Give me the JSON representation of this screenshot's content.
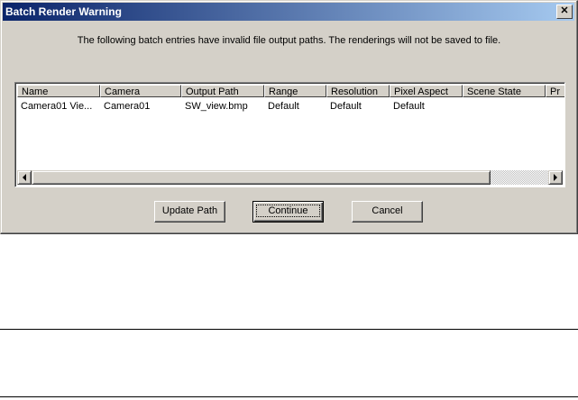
{
  "dialog": {
    "title": "Batch Render Warning",
    "close_glyph": "✕",
    "message": "The following batch entries have invalid file output paths. The renderings will not be saved to file."
  },
  "table": {
    "columns": [
      "Name",
      "Camera",
      "Output Path",
      "Range",
      "Resolution",
      "Pixel Aspect",
      "Scene State",
      "Pr"
    ],
    "rows": [
      [
        "Camera01 Vie...",
        "Camera01",
        "SW_view.bmp",
        "Default",
        "Default",
        "Default",
        "",
        ""
      ]
    ]
  },
  "buttons": {
    "update_path": "Update Path",
    "continue": "Continue",
    "cancel": "Cancel"
  },
  "icons": {
    "scroll_left": "triangle-left-icon",
    "scroll_right": "triangle-right-icon"
  }
}
